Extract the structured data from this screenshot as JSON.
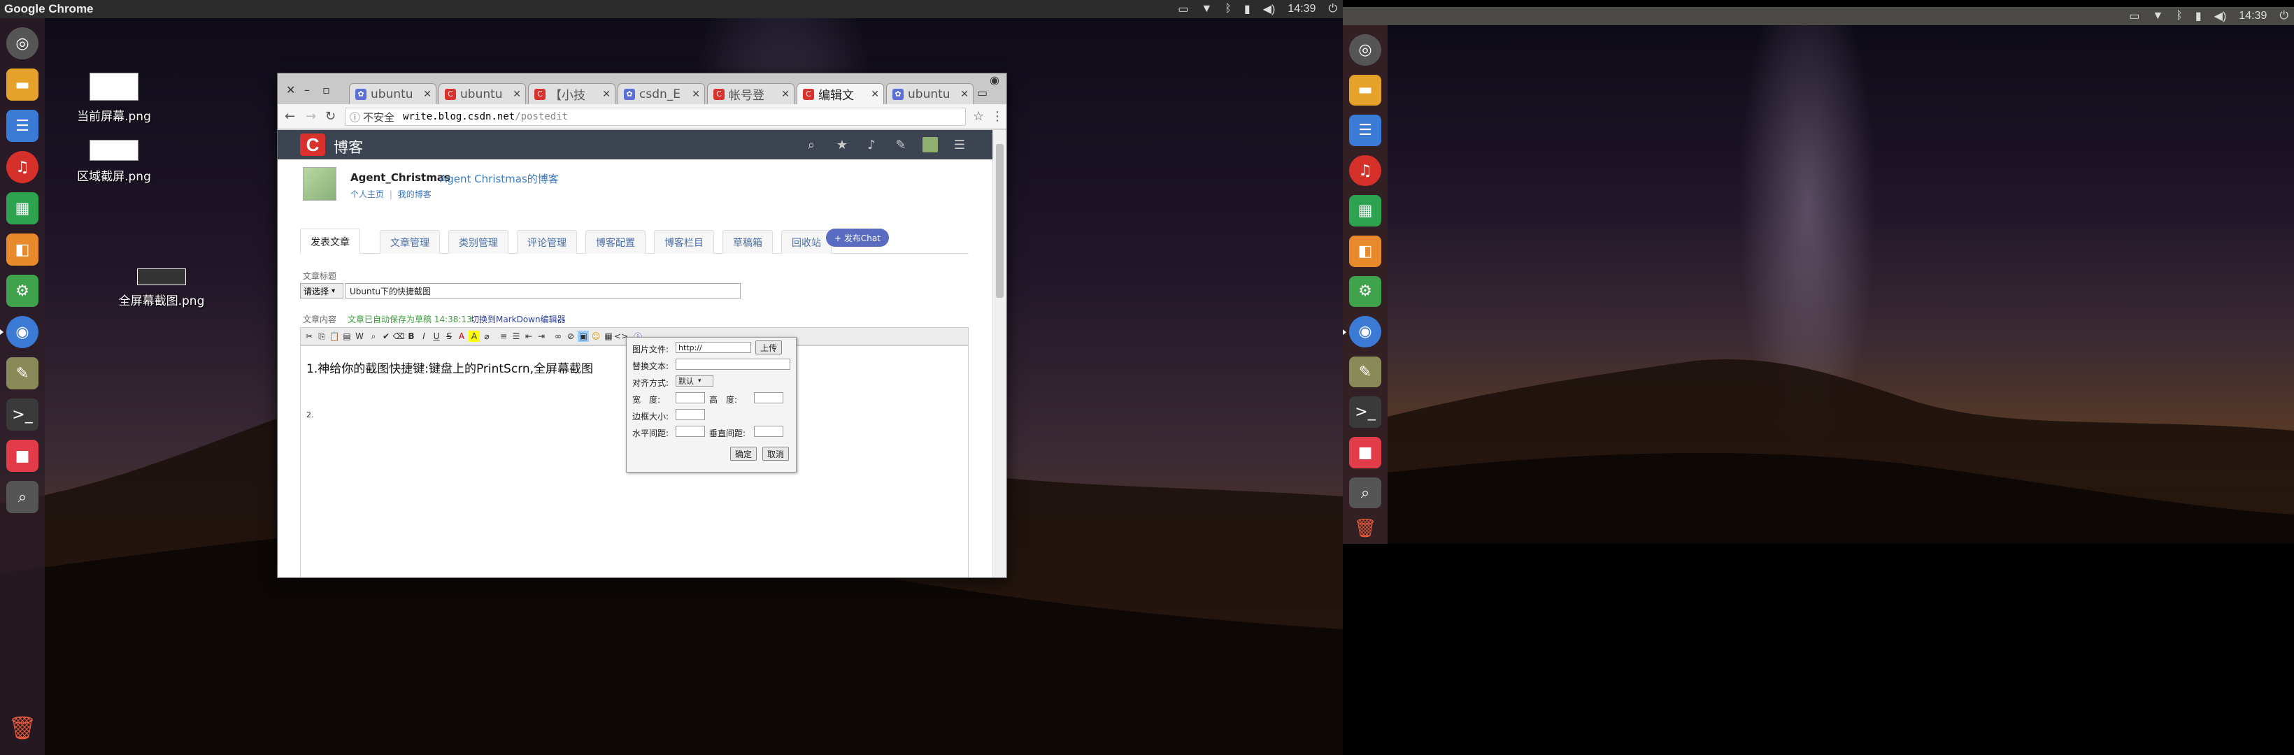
{
  "top_panel": {
    "app_title": "Google Chrome",
    "clock": "14:39"
  },
  "second_panel": {
    "clock": "14:39"
  },
  "desktop_icons": [
    {
      "label": "当前屏幕.png"
    },
    {
      "label": "区域截屏.png"
    },
    {
      "label": "全屏幕截图.png"
    }
  ],
  "launcher": {
    "items": [
      {
        "name": "ubuntu",
        "color": "#555555"
      },
      {
        "name": "files",
        "color": "#e6a12a"
      },
      {
        "name": "text-editor",
        "color": "#3a7bd5"
      },
      {
        "name": "netease-music",
        "color": "#d6302a"
      },
      {
        "name": "calc",
        "color": "#2ea34f"
      },
      {
        "name": "impress",
        "color": "#e88a2b"
      },
      {
        "name": "settings",
        "color": "#3fa34b"
      },
      {
        "name": "chrome",
        "color": "#3b7bd6"
      },
      {
        "name": "inkscape",
        "color": "#8a8a58"
      },
      {
        "name": "terminal",
        "color": "#3a3a3a"
      },
      {
        "name": "recorder",
        "color": "#e23c4b"
      },
      {
        "name": "screenshot",
        "color": "#555555"
      }
    ]
  },
  "browser": {
    "tabs": [
      {
        "label": "ubuntu",
        "fav_color": "#5b6fd6"
      },
      {
        "label": "ubuntu",
        "fav_color": "#d9312b"
      },
      {
        "label": "【小技",
        "fav_color": "#d9312b"
      },
      {
        "label": "csdn_E",
        "fav_color": "#5b6fd6"
      },
      {
        "label": "帐号登",
        "fav_color": "#d9312b"
      },
      {
        "label": "编辑文",
        "fav_color": "#d9312b"
      },
      {
        "label": "ubuntu",
        "fav_color": "#5b6fd6"
      }
    ],
    "security": "不安全",
    "url_host": "write.blog.csdn.net",
    "url_path": "/postedit"
  },
  "csdn": {
    "logo": "C",
    "site_name": "博客",
    "username": "Agent_Christmas",
    "blog_name": "Agent Christmas的博客",
    "link_home": "个人主页",
    "link_blog": "我的博客",
    "nav_tabs": [
      "发表文章",
      "文章管理",
      "类别管理",
      "评论管理",
      "博客配置",
      "博客栏目",
      "草稿箱",
      "回收站"
    ],
    "chat_button": "+ 发布Chat",
    "title_label": "文章标题",
    "category_select": "请选择",
    "title_value": "Ubuntu下的快捷截图",
    "content_label": "文章内容",
    "autosave": "文章已自动保存为草稿 14:38:13",
    "md_switch": "切换到MarkDown编辑器",
    "editor_line1": "1.神给你的截图快捷键:键盘上的PrintScrn,全屏幕截图",
    "editor_line2": "2."
  },
  "image_dialog": {
    "file_label": "图片文件:",
    "file_value": "http://",
    "upload": "上传",
    "alt_label": "替换文本:",
    "align_label": "对齐方式:",
    "align_value": "默认",
    "width_label": "宽　度:",
    "height_label": "高　度:",
    "border_label": "边框大小:",
    "hspace_label": "水平间距:",
    "vspace_label": "垂直间距:",
    "ok": "确定",
    "cancel": "取消"
  }
}
